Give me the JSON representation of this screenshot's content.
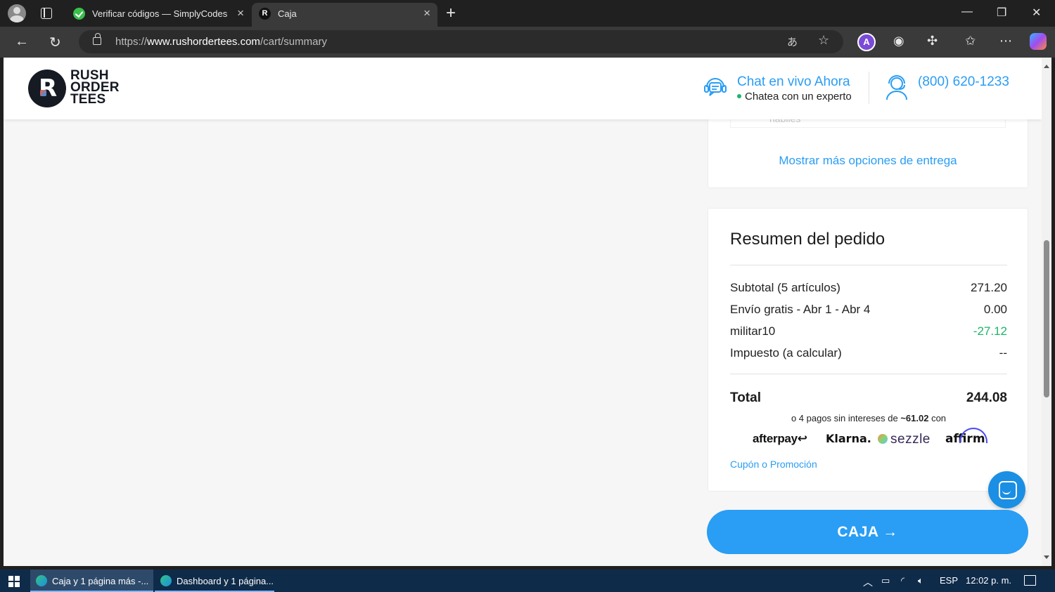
{
  "browser": {
    "tabs": [
      {
        "title": "Verificar códigos — SimplyCodes",
        "active": false
      },
      {
        "title": "Caja",
        "active": true
      }
    ],
    "url": {
      "scheme": "https://",
      "host": "www.rushordertees.com",
      "path": "/cart/summary"
    },
    "extension_letter": "A"
  },
  "header": {
    "logo_lines": [
      "RUSH",
      "ORDER",
      "TEES"
    ],
    "logo_mark_letter": "R",
    "chat_title": "Chat en vivo Ahora",
    "chat_subtitle": "Chatea con un experto",
    "phone": "(800) 620-1233"
  },
  "delivery": {
    "faded_option_text": "hábiles",
    "more_options_link": "Mostrar más opciones de entrega"
  },
  "summary": {
    "title": "Resumen del pedido",
    "rows": [
      {
        "label": "Subtotal (5 artículos)",
        "value": "271.20"
      },
      {
        "label": "Envío gratis - Abr 1 - Abr 4",
        "value": "0.00"
      },
      {
        "label": "militar10",
        "value": "-27.12"
      },
      {
        "label": "Impuesto (a calcular)",
        "value": "--"
      }
    ],
    "total_label": "Total",
    "total_value": "244.08",
    "installments_prefix": "o 4 pagos sin intereses de ",
    "installments_amount": "~61.02",
    "installments_suffix": " con",
    "payment_providers": [
      "afterpay",
      "Klarna.",
      "sezzle",
      "affirm"
    ],
    "coupon_link": "Cupón o Promoción",
    "discount_color": "#1bb56b"
  },
  "checkout_button": "CAJA →",
  "accent_color": "#2a9df4",
  "taskbar": {
    "items": [
      "Caja y 1 página más -...",
      "Dashboard y 1 página..."
    ],
    "language": "ESP",
    "time": "12:02 p. m."
  }
}
